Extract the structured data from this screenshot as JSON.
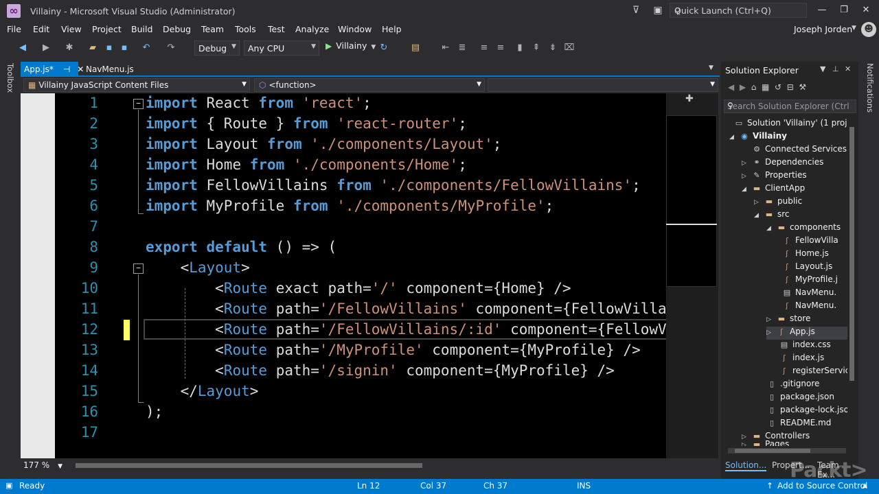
{
  "window": {
    "title": "Villainy - Microsoft Visual Studio  (Administrator)",
    "quick_launch_placeholder": "Quick Launch (Ctrl+Q)"
  },
  "menu": [
    "File",
    "Edit",
    "View",
    "Project",
    "Build",
    "Debug",
    "Team",
    "Tools",
    "Test",
    "Analyze",
    "Window",
    "Help"
  ],
  "user": {
    "name": "Joseph Jorden"
  },
  "toolbar": {
    "config": "Debug",
    "platform": "Any CPU",
    "run_label": "Villainy"
  },
  "side": {
    "toolbox": "Toolbox",
    "notifications": "Notifications"
  },
  "tabs": [
    {
      "label": "App.js*",
      "active": true
    },
    {
      "label": "NavMenu.js",
      "active": false
    }
  ],
  "navbar": {
    "project": "Villainy JavaScript Content Files",
    "scope": "<function>"
  },
  "editor": {
    "line_numbers": [
      "1",
      "2",
      "3",
      "4",
      "5",
      "6",
      "7",
      "8",
      "9",
      "10",
      "11",
      "12",
      "13",
      "14",
      "15",
      "16",
      "17"
    ],
    "zoom": "177 %"
  },
  "solution_explorer": {
    "title": "Solution Explorer",
    "search_placeholder": "Search Solution Explorer (Ctrl",
    "nodes": [
      "Solution 'Villainy' (1 project",
      "Villainy",
      "Connected Services",
      "Dependencies",
      "Properties",
      "ClientApp",
      "public",
      "src",
      "components",
      "FellowVilla",
      "Home.js",
      "Layout.js",
      "MyProfile.j",
      "NavMenu.",
      "NavMenu.",
      "store",
      "App.js",
      "index.css",
      "index.js",
      "registerServic",
      ".gitignore",
      "package.json",
      "package-lock.jsor",
      "README.md",
      "Controllers",
      "Pages"
    ],
    "bottom_tabs": [
      "Solution...",
      "Propert...",
      "Team Ex..."
    ]
  },
  "status": {
    "ready": "Ready",
    "ln": "Ln 12",
    "col": "Col 37",
    "ch": "Ch 37",
    "mode": "INS",
    "source_control": "Add to Source Control"
  },
  "watermark": "Packt>"
}
